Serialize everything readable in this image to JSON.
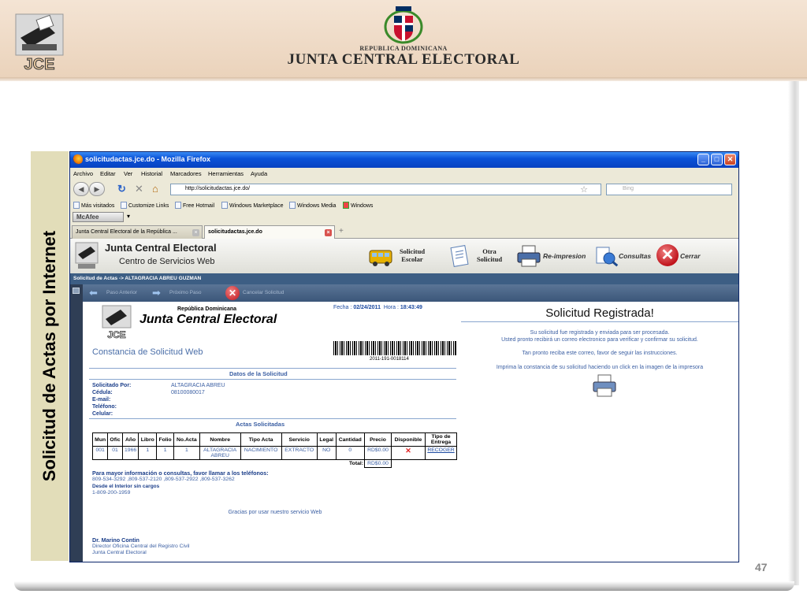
{
  "slide": {
    "republica": "REPUBLICA DOMINICANA",
    "title": "JUNTA CENTRAL ELECTORAL",
    "logo_text": "JCE",
    "side_label": "Solicitud de Actas por Internet",
    "page_number": "47"
  },
  "browser": {
    "window_title": "solicitudactas.jce.do - Mozilla Firefox",
    "menu": [
      "Archivo",
      "Editar",
      "Ver",
      "Historial",
      "Marcadores",
      "Herramientas",
      "Ayuda"
    ],
    "url": "http://solicitudactas.jce.do/",
    "search_placeholder": "Bing",
    "bookmarks": [
      "Más visitados",
      "Customize Links",
      "Free Hotmail",
      "Windows Marketplace",
      "Windows Media",
      "Windows"
    ],
    "mcafee": "McAfee",
    "tabs": [
      {
        "label": "Junta Central Electoral de la República ..."
      },
      {
        "label": "solicitudactas.jce.do"
      }
    ]
  },
  "site": {
    "title": "Junta Central Electoral",
    "subtitle": "Centro de Servicios Web",
    "toolbar": {
      "solicitud_escolar": [
        "Solicitud",
        "Escolar"
      ],
      "otra_solicitud": [
        "Otra",
        "Solicitud"
      ],
      "reimpresion": "Re-impresion",
      "consultas": "Consultas",
      "cerrar": "Cerrar"
    },
    "breadcrumb": "Solicitud de Actas -> ALTAGRACIA ABREU GUZMAN",
    "wizard": {
      "prev": "Paso Anterior",
      "next": "Próximo Paso",
      "cancel": "Cancelar Solicitud"
    }
  },
  "constancia": {
    "fecha_label": "Fecha :",
    "fecha": "02/24/2011",
    "hora_label": "Hora :",
    "hora": "18:43:49",
    "republica": "República Dominicana",
    "org": "Junta Central Electoral",
    "barcode_number": "2011-191-0018114",
    "title": "Constancia de Solicitud Web",
    "datos_title": "Datos de la Solicitud",
    "fields": [
      {
        "label": "Solicitado Por:",
        "value": "ALTAGRACIA ABREU"
      },
      {
        "label": "Cédula:",
        "value": "08100080017"
      },
      {
        "label": "E-mail:",
        "value": ""
      },
      {
        "label": "Teléfono:",
        "value": ""
      },
      {
        "label": "Celular:",
        "value": ""
      }
    ],
    "actas_title": "Actas Solicitadas",
    "table": {
      "headers": [
        "Mun",
        "Ofic",
        "Año",
        "Libro",
        "Folio",
        "No.Acta",
        "Nombre",
        "Tipo Acta",
        "Servicio",
        "Legal",
        "Cantidad",
        "Precio",
        "Disponible",
        "Tipo de Entrega"
      ],
      "row": [
        "001",
        "01",
        "1966",
        "1",
        "1",
        "1",
        "ALTAGRACIA ABREU",
        "NACIMIENTO",
        "EXTRACTO",
        "NO",
        "0",
        "RD$0.00",
        "✕",
        "RECOGER"
      ],
      "total_label": "Total:",
      "total_value": "RD$0.00"
    },
    "info_title": "Para mayor información o consultas, favor llamar a los teléfonos:",
    "phones": "809-534-3292 ,809-537-2120 ,809-537-2922 ,809-537-3262",
    "interior_label": "Desde el Interior sin cargos",
    "interior_phone": "1-809-200-1959",
    "thanks": "Gracias por usar nuestro servicio Web",
    "signer_name": "Dr. Marino Contin",
    "signer_role": "Director Oficina Central del Registro Civil",
    "signer_org": "Junta Central Electoral"
  },
  "registrada": {
    "title": "Solicitud Registrada!",
    "msg1": "Su solicitud fue registrada y enviada para ser procesada.",
    "msg2": "Usted pronto recibirá un correo electronico para verificar y confirmar su solicitud.",
    "msg3": "Tan pronto reciba este correo, favor de seguir las instrucciones.",
    "msg4": "Imprima la constancia de su solicitud haciendo un click en la imagen de la impresora"
  }
}
